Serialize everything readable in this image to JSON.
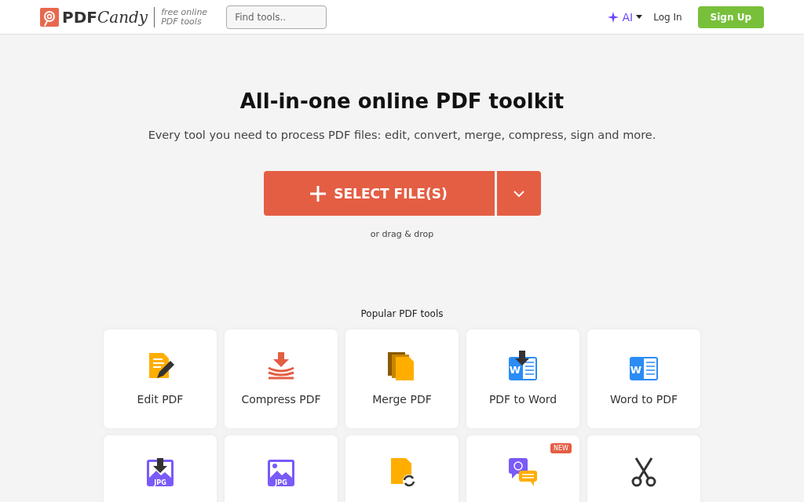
{
  "header": {
    "brand_bold": "PDF",
    "brand_script": "Candy",
    "tagline": [
      "free online",
      "PDF tools"
    ],
    "search": {
      "placeholder": "Find tools.."
    },
    "ai_menu": "AI",
    "login": "Log In",
    "signup": "Sign Up"
  },
  "hero": {
    "title": "All-in-one online PDF toolkit",
    "subtitle": "Every tool you need to process PDF files: edit, convert, merge, compress, sign and more.",
    "select_button": "SELECT FILE(S)",
    "drop_hint": "or drag & drop"
  },
  "popular": {
    "heading": "Popular PDF tools",
    "tools": [
      {
        "kind": "edit",
        "label": "Edit PDF"
      },
      {
        "kind": "compress",
        "label": "Compress PDF"
      },
      {
        "kind": "merge",
        "label": "Merge PDF"
      },
      {
        "kind": "wordget",
        "label": "PDF to Word",
        "icon_text": "W"
      },
      {
        "kind": "word",
        "label": "Word to PDF",
        "icon_text": "W"
      },
      {
        "kind": "jpgget",
        "icon_text": "JPG"
      },
      {
        "kind": "jpg",
        "icon_text": "JPG"
      },
      {
        "kind": "refresh"
      },
      {
        "kind": "chat",
        "badge": "NEW"
      },
      {
        "kind": "scissors"
      }
    ]
  }
}
